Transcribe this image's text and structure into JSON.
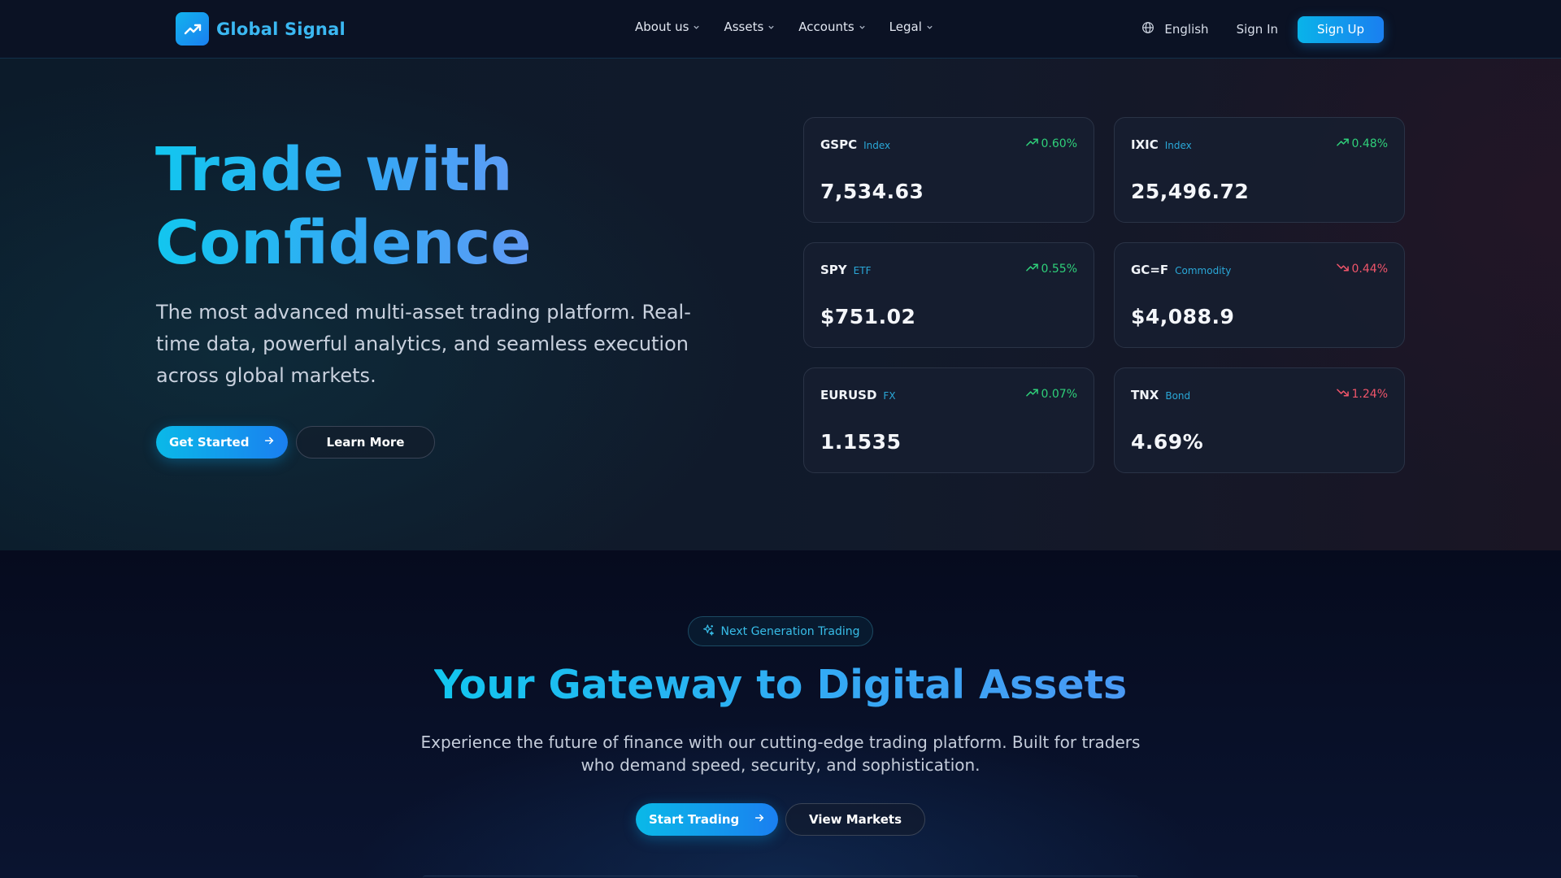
{
  "brand": {
    "name": "Global Signal"
  },
  "nav": {
    "items": [
      {
        "label": "About us"
      },
      {
        "label": "Assets"
      },
      {
        "label": "Accounts"
      },
      {
        "label": "Legal"
      }
    ],
    "language": "English",
    "sign_in": "Sign In",
    "sign_up": "Sign Up"
  },
  "hero": {
    "title_line1": "Trade with",
    "title_line2": "Confidence",
    "subtitle": "The most advanced multi-asset trading platform. Real-time data, powerful analytics, and seamless execution across global markets.",
    "primary_button": "Get Started",
    "secondary_button": "Learn More"
  },
  "tickers": [
    {
      "symbol": "GSPC",
      "category": "Index",
      "change": "0.60%",
      "direction": "up",
      "price": "7,534.63"
    },
    {
      "symbol": "IXIC",
      "category": "Index",
      "change": "0.48%",
      "direction": "up",
      "price": "25,496.72"
    },
    {
      "symbol": "SPY",
      "category": "ETF",
      "change": "0.55%",
      "direction": "up",
      "price": "$751.02"
    },
    {
      "symbol": "GC=F",
      "category": "Commodity",
      "change": "0.44%",
      "direction": "down",
      "price": "$4,088.9"
    },
    {
      "symbol": "EURUSD",
      "category": "FX",
      "change": "0.07%",
      "direction": "up",
      "price": "1.1535"
    },
    {
      "symbol": "TNX",
      "category": "Bond",
      "change": "1.24%",
      "direction": "down",
      "price": "4.69%"
    }
  ],
  "section2": {
    "badge": "Next Generation Trading",
    "title": "Your Gateway to Digital Assets",
    "subtitle": "Experience the future of finance with our cutting-edge trading platform. Built for traders who demand speed, security, and sophistication.",
    "primary_button": "Start Trading",
    "secondary_button": "View Markets"
  },
  "colors": {
    "accent": "#12b3ee",
    "up": "#2fd07a",
    "down": "#f0556a",
    "category": "#2aa8d8"
  },
  "icons": {
    "logo": "trending-up-icon",
    "language": "globe-icon",
    "dropdown": "chevron-down-icon",
    "button_arrow": "arrow-right-icon",
    "badge": "sparkles-icon",
    "change_up": "trending-up-icon",
    "change_down": "trending-down-icon"
  }
}
